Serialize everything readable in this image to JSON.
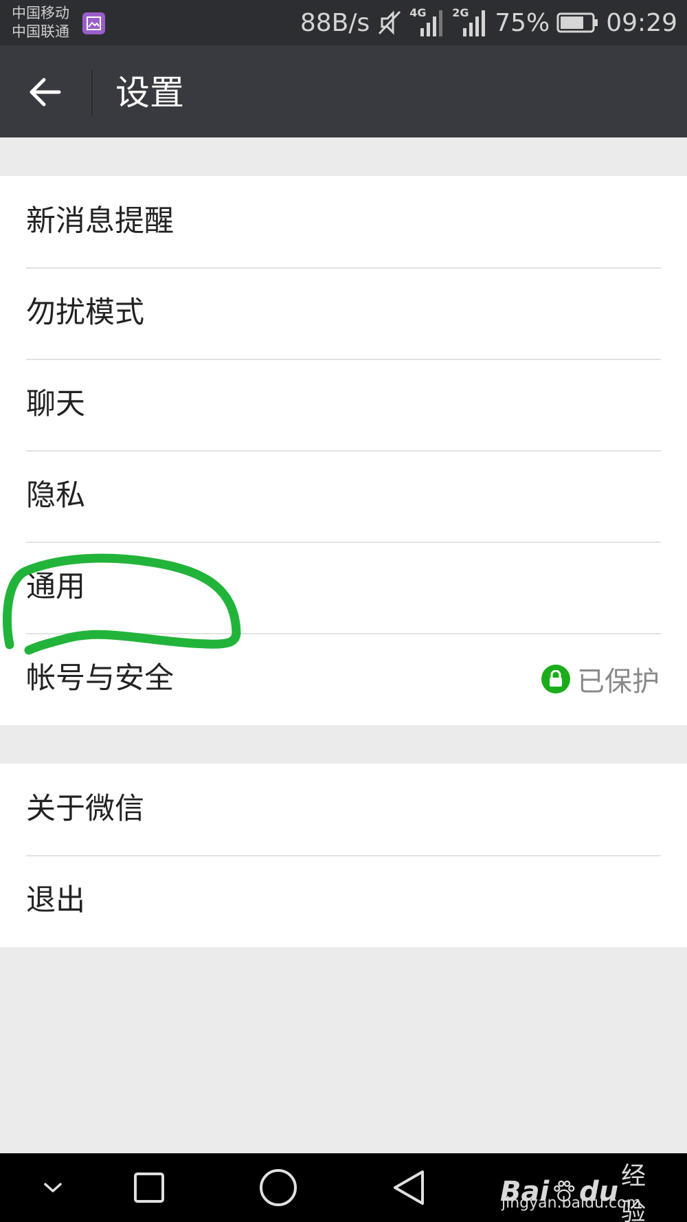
{
  "status_bar": {
    "carrier_1": "中国移动",
    "carrier_2": "中国联通",
    "net_speed": "88B/s",
    "net_4g": "4G",
    "net_2g": "2G",
    "battery": "75%",
    "battery_level": 0.75,
    "time": "09:29"
  },
  "app_bar": {
    "title": "设置"
  },
  "settings": {
    "group1": [
      {
        "label": "新消息提醒"
      },
      {
        "label": "勿扰模式"
      },
      {
        "label": "聊天"
      },
      {
        "label": "隐私"
      },
      {
        "label": "通用"
      },
      {
        "label": "帐号与安全",
        "extra": "已保护"
      }
    ],
    "group2": [
      {
        "label": "关于微信"
      },
      {
        "label": "退出"
      }
    ]
  },
  "watermark": {
    "logo": "Bai",
    "logo_end": "du",
    "name": "经验",
    "url": "jingyan.baidu.com"
  },
  "colors": {
    "status_bar": "#2d2e32",
    "app_bar": "#393a3f",
    "background": "#ebebeb",
    "accent_green": "#1aad19",
    "annotation": "#22b43a"
  }
}
